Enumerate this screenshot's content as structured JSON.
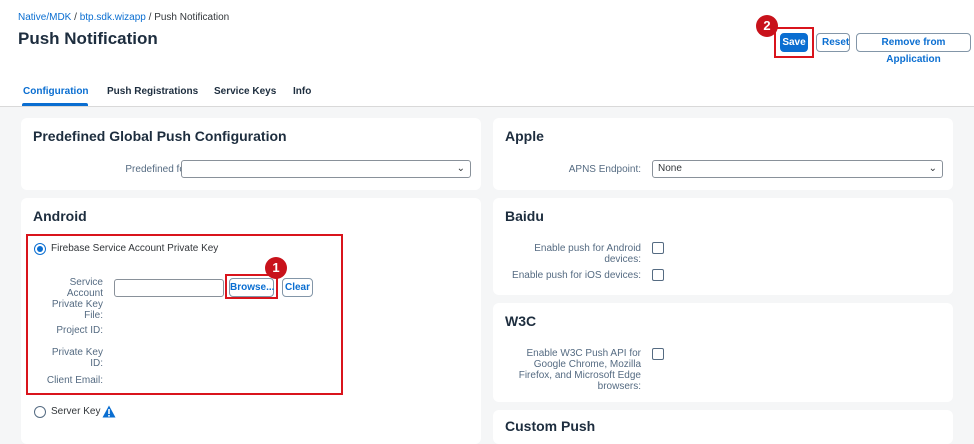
{
  "header": {
    "breadcrumb": [
      {
        "label": "Native/MDK"
      },
      {
        "label": "btp.sdk.wizapp"
      },
      {
        "label": "Push Notification"
      }
    ],
    "separator": " / ",
    "title": "Push Notification",
    "actions": {
      "save_label": "Save",
      "reset_label": "Reset",
      "remove_label": "Remove from Application"
    }
  },
  "annotations": {
    "marker_1": "1",
    "marker_2": "2"
  },
  "tabs": [
    {
      "label": "Configuration",
      "active": true
    },
    {
      "label": "Push Registrations",
      "active": false
    },
    {
      "label": "Service Keys",
      "active": false
    },
    {
      "label": "Info",
      "active": false
    }
  ],
  "predefined": {
    "title": "Predefined Global Push Configuration",
    "field_label": "Predefined for:",
    "value": ""
  },
  "android": {
    "title": "Android",
    "firebase_option": "Firebase Service Account Private Key",
    "firebase_selected": true,
    "service_account_label": "Service Account Private Key File:",
    "browse_label": "Browse...",
    "clear_label": "Clear",
    "project_id_label": "Project ID:",
    "private_key_id_label": "Private Key ID:",
    "client_email_label": "Client Email:",
    "server_key_option": "Server Key",
    "server_key_icon": "warning-icon"
  },
  "apple": {
    "title": "Apple",
    "endpoint_label": "APNS Endpoint:",
    "endpoint_value": "None"
  },
  "baidu": {
    "title": "Baidu",
    "android_label": "Enable push for Android devices:",
    "ios_label": "Enable push for iOS devices:"
  },
  "w3c": {
    "title": "W3C",
    "push_api_label": "Enable W3C Push API for Google Chrome, Mozilla Firefox, and Microsoft Edge browsers:"
  },
  "custom_push": {
    "title": "Custom Push"
  },
  "colors": {
    "accent": "#0a6ed1",
    "highlight": "#d9141c",
    "marker": "#c8121b",
    "warning": "#0a6ed1"
  }
}
